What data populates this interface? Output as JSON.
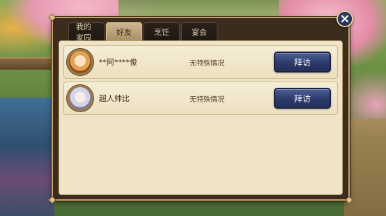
{
  "tabs": [
    {
      "label": "我的家园",
      "active": false
    },
    {
      "label": "好友",
      "active": true
    },
    {
      "label": "烹饪",
      "active": false
    },
    {
      "label": "宴会",
      "active": false
    }
  ],
  "friends": [
    {
      "name": "**阿****俊",
      "status": "无特殊情况",
      "action": "拜访"
    },
    {
      "name": "超人帅比",
      "status": "无特殊情况",
      "action": "拜访"
    }
  ],
  "icons": {
    "close": "close-icon"
  },
  "colors": {
    "visit_button": "#2c3a6a",
    "active_tab": "#cdb690",
    "panel_bg": "#efe4c8"
  }
}
